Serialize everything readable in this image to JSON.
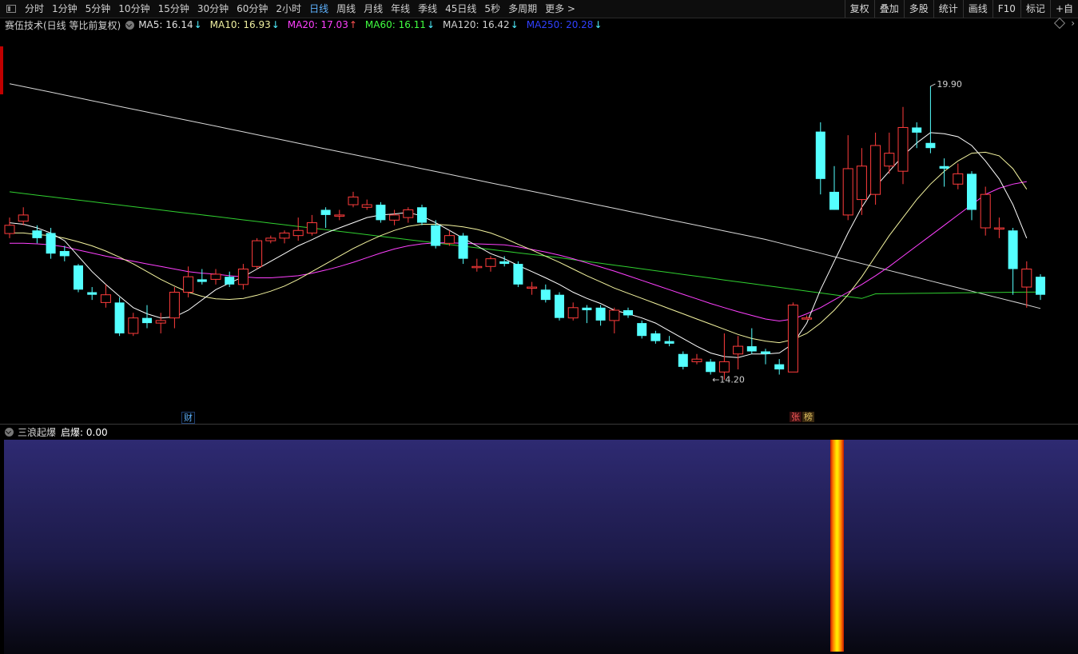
{
  "toolbar": {
    "periods": [
      "分时",
      "1分钟",
      "5分钟",
      "10分钟",
      "15分钟",
      "30分钟",
      "60分钟",
      "2小时",
      "日线",
      "周线",
      "月线",
      "年线",
      "季线",
      "45日线",
      "5秒",
      "多周期",
      "更多 >"
    ],
    "active_period": "日线",
    "tools": [
      "复权",
      "叠加",
      "多股",
      "统计",
      "画线",
      "F10",
      "标记",
      "+自"
    ]
  },
  "legend": {
    "stock": "赛伍技术(日线 等比前复权)",
    "mas": [
      {
        "label": "MA5: 16.14",
        "dir": "down",
        "color": "#e0e0e0"
      },
      {
        "label": "MA10: 16.93",
        "dir": "down",
        "color": "#f0f0a0"
      },
      {
        "label": "MA20: 17.03",
        "dir": "up",
        "color": "#ff40ff"
      },
      {
        "label": "MA60: 16.11",
        "dir": "down",
        "color": "#40ff40"
      },
      {
        "label": "MA120: 16.42",
        "dir": "down",
        "color": "#d0d0d0"
      },
      {
        "label": "MA250: 20.28",
        "dir": "down",
        "color": "#3040ff"
      }
    ]
  },
  "chart_data": {
    "type": "candlestick",
    "ylim": [
      13.5,
      20.8
    ],
    "high_label": "19.90",
    "low_label": "14.20",
    "colors": {
      "up": "#ff3c3c",
      "down": "#54ffff",
      "ma5": "#ffffff",
      "ma10": "#f5f5a0",
      "ma20": "#ff40ff",
      "ma60": "#30d030",
      "ma120": "#d8d8d8"
    },
    "candles": [
      [
        17.04,
        17.2,
        17.35,
        16.95
      ],
      [
        17.28,
        17.4,
        17.55,
        17.2
      ],
      [
        17.1,
        16.95,
        17.2,
        16.85
      ],
      [
        17.05,
        16.65,
        17.15,
        16.55
      ],
      [
        16.7,
        16.6,
        16.8,
        16.5
      ],
      [
        16.42,
        15.95,
        16.45,
        15.9
      ],
      [
        15.9,
        15.85,
        16.0,
        15.75
      ],
      [
        15.7,
        15.85,
        16.05,
        15.6
      ],
      [
        15.7,
        15.1,
        15.8,
        15.05
      ],
      [
        15.1,
        15.4,
        15.5,
        15.05
      ],
      [
        15.4,
        15.3,
        15.65,
        15.2
      ],
      [
        15.3,
        15.35,
        15.5,
        15.1
      ],
      [
        15.4,
        15.9,
        16.0,
        15.2
      ],
      [
        15.9,
        16.2,
        16.4,
        15.8
      ],
      [
        16.15,
        16.1,
        16.35,
        16.05
      ],
      [
        16.15,
        16.25,
        16.35,
        16.05
      ],
      [
        16.2,
        16.05,
        16.3,
        16.0
      ],
      [
        16.05,
        16.35,
        16.45,
        15.95
      ],
      [
        16.4,
        16.9,
        16.95,
        16.35
      ],
      [
        16.9,
        16.95,
        17.0,
        16.85
      ],
      [
        16.95,
        17.05,
        17.1,
        16.85
      ],
      [
        17.0,
        17.1,
        17.35,
        16.9
      ],
      [
        17.05,
        17.25,
        17.4,
        17.0
      ],
      [
        17.5,
        17.4,
        17.55,
        17.15
      ],
      [
        17.4,
        17.4,
        17.5,
        17.3
      ],
      [
        17.6,
        17.75,
        17.85,
        17.55
      ],
      [
        17.55,
        17.6,
        17.7,
        17.5
      ],
      [
        17.6,
        17.3,
        17.65,
        17.25
      ],
      [
        17.3,
        17.4,
        17.5,
        17.2
      ],
      [
        17.35,
        17.5,
        17.55,
        17.25
      ],
      [
        17.55,
        17.25,
        17.6,
        17.2
      ],
      [
        17.2,
        16.8,
        17.3,
        16.75
      ],
      [
        16.85,
        17.0,
        17.1,
        16.8
      ],
      [
        17.0,
        16.55,
        17.05,
        16.45
      ],
      [
        16.4,
        16.4,
        16.55,
        16.3
      ],
      [
        16.4,
        16.55,
        16.6,
        16.3
      ],
      [
        16.5,
        16.45,
        16.6,
        16.4
      ],
      [
        16.45,
        16.05,
        16.5,
        16.0
      ],
      [
        16.0,
        16.0,
        16.1,
        15.85
      ],
      [
        15.95,
        15.75,
        16.05,
        15.7
      ],
      [
        15.85,
        15.4,
        15.9,
        15.35
      ],
      [
        15.4,
        15.6,
        15.7,
        15.35
      ],
      [
        15.6,
        15.55,
        15.65,
        15.3
      ],
      [
        15.6,
        15.35,
        15.65,
        15.25
      ],
      [
        15.35,
        15.55,
        15.6,
        15.1
      ],
      [
        15.55,
        15.45,
        15.6,
        15.4
      ],
      [
        15.3,
        15.05,
        15.35,
        15.0
      ],
      [
        15.1,
        14.95,
        15.15,
        14.9
      ],
      [
        14.95,
        14.9,
        15.05,
        14.85
      ],
      [
        14.7,
        14.45,
        14.75,
        14.4
      ],
      [
        14.55,
        14.6,
        14.7,
        14.5
      ],
      [
        14.55,
        14.35,
        14.6,
        14.3
      ],
      [
        14.35,
        14.55,
        15.1,
        14.2
      ],
      [
        14.7,
        14.85,
        15.05,
        14.4
      ],
      [
        14.85,
        14.75,
        15.2,
        14.7
      ],
      [
        14.75,
        14.7,
        14.8,
        14.5
      ],
      [
        14.5,
        14.4,
        14.6,
        14.3
      ],
      [
        14.35,
        15.65,
        15.7,
        14.35
      ],
      [
        15.4,
        15.4,
        15.45,
        15.4
      ],
      [
        19.02,
        18.1,
        19.2,
        17.8
      ],
      [
        17.85,
        17.5,
        18.35,
        17.5
      ],
      [
        17.4,
        18.3,
        18.95,
        17.3
      ],
      [
        17.7,
        18.35,
        18.7,
        17.4
      ],
      [
        17.8,
        18.75,
        19.0,
        17.6
      ],
      [
        18.35,
        18.6,
        19.0,
        18.2
      ],
      [
        18.25,
        19.1,
        19.5,
        18.0
      ],
      [
        19.1,
        19.0,
        19.2,
        18.7
      ],
      [
        18.8,
        18.7,
        19.9,
        18.6
      ],
      [
        18.35,
        18.3,
        18.5,
        17.95
      ],
      [
        18.0,
        18.2,
        18.4,
        17.9
      ],
      [
        18.2,
        17.5,
        18.25,
        17.3
      ],
      [
        17.15,
        17.8,
        17.95,
        17.0
      ],
      [
        17.15,
        17.15,
        17.35,
        16.95
      ],
      [
        17.1,
        16.35,
        17.15,
        15.85
      ],
      [
        16.0,
        16.35,
        16.5,
        15.6
      ],
      [
        16.2,
        15.85,
        16.25,
        15.75
      ]
    ],
    "ma5": [
      17.25,
      17.22,
      17.15,
      17.05,
      16.9,
      16.6,
      16.3,
      16.05,
      15.82,
      15.6,
      15.48,
      15.4,
      15.42,
      15.55,
      15.75,
      15.95,
      16.08,
      16.2,
      16.35,
      16.5,
      16.65,
      16.8,
      16.92,
      17.05,
      17.15,
      17.25,
      17.35,
      17.4,
      17.42,
      17.45,
      17.38,
      17.25,
      17.1,
      16.95,
      16.8,
      16.65,
      16.55,
      16.42,
      16.3,
      16.18,
      16.05,
      15.9,
      15.78,
      15.68,
      15.55,
      15.48,
      15.4,
      15.3,
      15.15,
      15.0,
      14.85,
      14.72,
      14.65,
      14.63,
      14.7,
      14.7,
      14.72,
      14.9,
      15.3,
      15.95,
      16.5,
      17.05,
      17.55,
      17.95,
      18.25,
      18.55,
      18.8,
      19.0,
      18.98,
      18.92,
      18.75,
      18.45,
      18.1,
      17.6,
      16.95
    ],
    "ma10": [
      17.05,
      17.05,
      17.02,
      17.0,
      16.95,
      16.88,
      16.8,
      16.7,
      16.58,
      16.45,
      16.3,
      16.15,
      16.02,
      15.9,
      15.82,
      15.77,
      15.76,
      15.78,
      15.84,
      15.92,
      16.02,
      16.15,
      16.3,
      16.45,
      16.6,
      16.75,
      16.88,
      17.0,
      17.1,
      17.18,
      17.22,
      17.22,
      17.2,
      17.17,
      17.12,
      17.05,
      16.95,
      16.83,
      16.72,
      16.6,
      16.48,
      16.35,
      16.22,
      16.1,
      15.98,
      15.88,
      15.78,
      15.68,
      15.58,
      15.48,
      15.38,
      15.28,
      15.18,
      15.08,
      15.0,
      14.95,
      14.92,
      14.98,
      15.1,
      15.3,
      15.55,
      15.85,
      16.2,
      16.6,
      17.0,
      17.35,
      17.7,
      18.0,
      18.25,
      18.45,
      18.6,
      18.62,
      18.55,
      18.3,
      17.9
    ],
    "ma20": [
      16.85,
      16.85,
      16.84,
      16.82,
      16.78,
      16.72,
      16.66,
      16.6,
      16.55,
      16.5,
      16.45,
      16.4,
      16.35,
      16.3,
      16.27,
      16.25,
      16.22,
      16.2,
      16.18,
      16.18,
      16.2,
      16.22,
      16.27,
      16.33,
      16.4,
      16.48,
      16.57,
      16.66,
      16.74,
      16.8,
      16.84,
      16.86,
      16.86,
      16.85,
      16.84,
      16.83,
      16.82,
      16.78,
      16.73,
      16.68,
      16.62,
      16.55,
      16.47,
      16.39,
      16.31,
      16.22,
      16.13,
      16.04,
      15.95,
      15.86,
      15.77,
      15.68,
      15.6,
      15.52,
      15.45,
      15.38,
      15.34,
      15.38,
      15.48,
      15.6,
      15.75,
      15.9,
      16.05,
      16.22,
      16.4,
      16.6,
      16.8,
      17.0,
      17.2,
      17.4,
      17.6,
      17.8,
      17.92,
      18.0,
      18.05
    ]
  },
  "indicator": {
    "name": "三浪起爆",
    "value_label": "启爆: 0.00"
  },
  "badges": {
    "cai": "财",
    "zhang": "张",
    "bang": "榜"
  }
}
